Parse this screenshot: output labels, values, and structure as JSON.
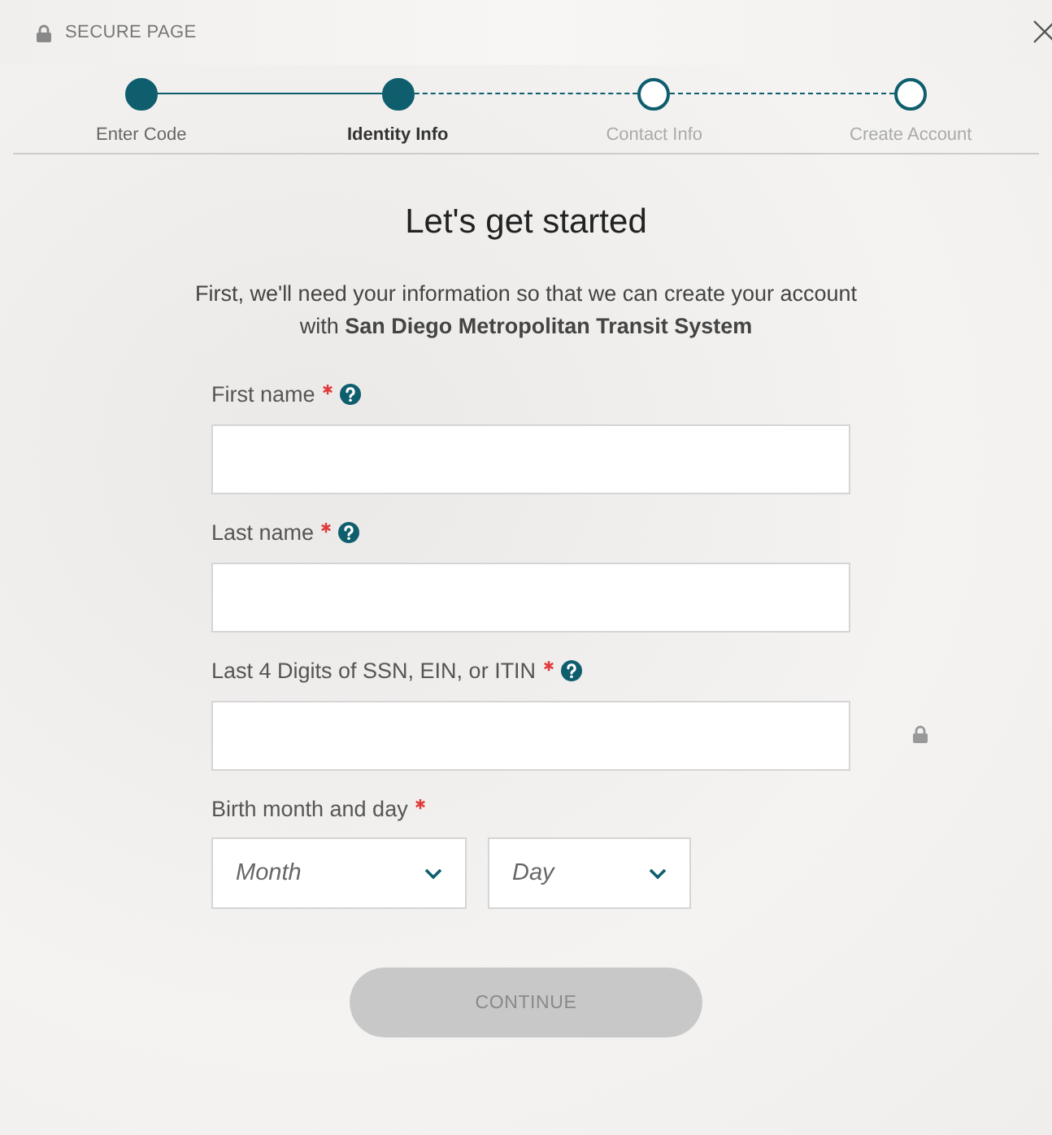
{
  "header": {
    "title": "SECURE PAGE"
  },
  "steps": [
    {
      "label": "Enter Code",
      "completed": true,
      "selected": false
    },
    {
      "label": "Identity Info",
      "completed": true,
      "selected": true
    },
    {
      "label": "Contact Info",
      "completed": false,
      "selected": false
    },
    {
      "label": "Create Account",
      "completed": false,
      "selected": false
    }
  ],
  "heading": "Let's get started",
  "intro": "First, we'll need your information so that we can create your account with **San Diego Metropolitan Transit System**",
  "fields": [
    {
      "label": "First name",
      "required": true,
      "help": true,
      "secure": false
    },
    {
      "label": "Last name",
      "required": true,
      "help": true,
      "secure": false
    },
    {
      "label": "Last 4 Digits of SSN, EIN, or ITIN",
      "required": true,
      "help": true,
      "secure": true
    }
  ],
  "birthday": {
    "label": "Birth month and day",
    "required": true,
    "selects": [
      {
        "placeholder": "Month"
      },
      {
        "placeholder": "Day"
      }
    ]
  },
  "continue_button": {
    "label": "CONTINUE",
    "disabled": true
  }
}
